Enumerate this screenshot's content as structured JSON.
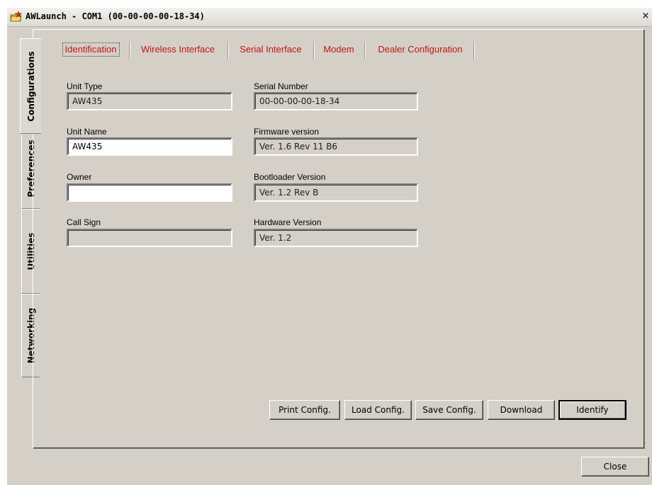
{
  "window": {
    "title": "AWLaunch - COM1  (00-00-00-00-18-34)",
    "close_glyph": "×",
    "app_icon": "folder-star-icon"
  },
  "side_tabs": [
    {
      "label": "Configurations",
      "active": true
    },
    {
      "label": "Preferences",
      "active": false
    },
    {
      "label": "Utilities",
      "active": false
    },
    {
      "label": "Networking",
      "active": false
    }
  ],
  "tabs": [
    {
      "label": "Identification",
      "active": true
    },
    {
      "label": "Wireless Interface",
      "active": false
    },
    {
      "label": "Serial Interface",
      "active": false
    },
    {
      "label": "Modem",
      "active": false
    },
    {
      "label": "Dealer Configuration",
      "active": false
    }
  ],
  "fields": {
    "unit_type": {
      "label": "Unit Type",
      "value": "AW435"
    },
    "unit_name": {
      "label": "Unit Name",
      "value": "AW435"
    },
    "owner": {
      "label": "Owner",
      "value": ""
    },
    "call_sign": {
      "label": "Call Sign",
      "value": ""
    },
    "serial_number": {
      "label": "Serial Number",
      "value": "00-00-00-00-18-34"
    },
    "firmware_version": {
      "label": "Firmware version",
      "value": "Ver. 1.6 Rev 11 B6"
    },
    "bootloader_version": {
      "label": "Bootloader Version",
      "value": "Ver. 1.2 Rev B"
    },
    "hardware_version": {
      "label": "Hardware Version",
      "value": "Ver. 1.2"
    }
  },
  "buttons": {
    "print_config": "Print Config.",
    "load_config": "Load Config.",
    "save_config": "Save Config.",
    "download": "Download",
    "identify": "Identify",
    "close": "Close"
  },
  "colors": {
    "tab_text": "#c41313",
    "dialog_bg": "#d4d0c8"
  }
}
